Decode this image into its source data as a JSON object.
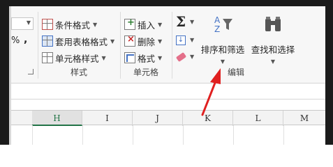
{
  "ribbon": {
    "partial_number": {
      "percent": "%",
      "comma": ","
    },
    "styles": {
      "conditional_format": "条件格式",
      "table_format": "套用表格格式",
      "cell_styles": "单元格样式",
      "label": "样式"
    },
    "cells": {
      "insert": "插入",
      "delete": "删除",
      "format": "格式",
      "label": "单元格"
    },
    "editing": {
      "sort_filter": "排序和筛选",
      "find_select": "查找和选择",
      "label": "编辑",
      "sigma": "Σ"
    }
  },
  "sheet": {
    "columns": [
      "H",
      "I",
      "J",
      "K",
      "L",
      "M"
    ],
    "selected_column": "H"
  },
  "colors": {
    "frame": "#1b1b1b",
    "arrow": "#e02020",
    "selected_header": "#217346"
  }
}
